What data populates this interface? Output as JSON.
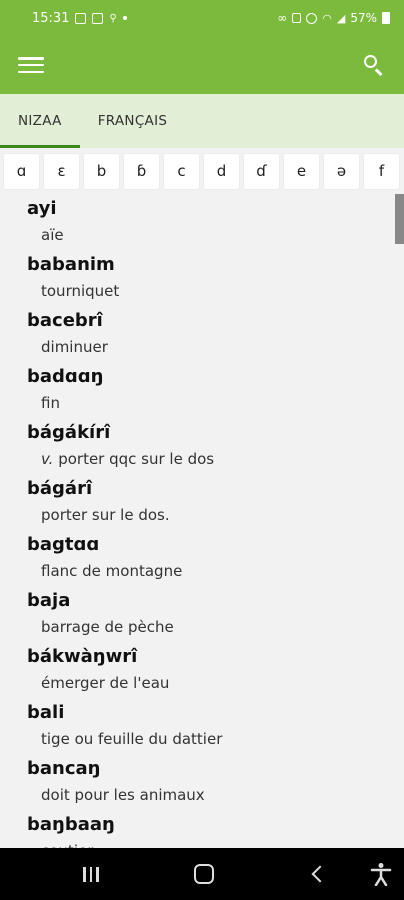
{
  "status_bar": {
    "time": "15:31",
    "battery": "57%",
    "icons": [
      "gallery-icon",
      "b-icon",
      "notification-icon",
      "dot-icon",
      "link-icon",
      "lock-icon",
      "alarm-icon",
      "wifi-icon",
      "signal-icon",
      "battery-icon"
    ]
  },
  "app_bar": {
    "menu_icon": "hamburger-menu-icon",
    "search_icon": "search-icon",
    "color": "#7cba3d"
  },
  "tabs": [
    {
      "label": "NIZAA",
      "active": true
    },
    {
      "label": "FRANÇAIS",
      "active": false
    }
  ],
  "alphabet": [
    "ɑ",
    "ɛ",
    "b",
    "ɓ",
    "c",
    "d",
    "ɗ",
    "e",
    "ə",
    "f"
  ],
  "entries": [
    {
      "headword": "ayi",
      "pos": "",
      "gloss": "aïe"
    },
    {
      "headword": "babanim",
      "pos": "",
      "gloss": "tourniquet"
    },
    {
      "headword": "bacebrî",
      "pos": "",
      "gloss": "diminuer"
    },
    {
      "headword": "badɑɑŋ",
      "pos": "",
      "gloss": "fin"
    },
    {
      "headword": "bágákírî",
      "pos": "v.",
      "gloss": "porter qqc sur le dos"
    },
    {
      "headword": "bágárî",
      "pos": "",
      "gloss": "porter sur le dos."
    },
    {
      "headword": "bagtɑɑ",
      "pos": "",
      "gloss": "flanc de montagne"
    },
    {
      "headword": "baja",
      "pos": "",
      "gloss": "barrage de pèche"
    },
    {
      "headword": "bákwàŋwrî",
      "pos": "",
      "gloss": "émerger de l'eau"
    },
    {
      "headword": "bali",
      "pos": "",
      "gloss": "tige ou feuille du dattier"
    },
    {
      "headword": "bancaŋ",
      "pos": "",
      "gloss": "doit pour les animaux"
    },
    {
      "headword": "baŋbaaŋ",
      "pos": "",
      "gloss": "coutier"
    }
  ],
  "nav_bar": {
    "buttons": [
      "recents-icon",
      "home-icon",
      "back-icon",
      "accessibility-icon"
    ]
  }
}
